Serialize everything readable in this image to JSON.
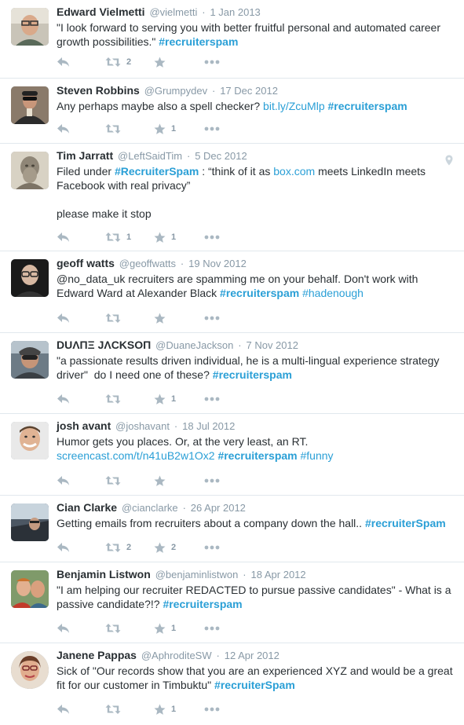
{
  "colors": {
    "link": "#2a9fd6",
    "muted": "#8899a6",
    "icon": "#aab8c2",
    "divider": "#e1e8ed"
  },
  "tweets": [
    {
      "fullname": "Edward Vielmetti",
      "username": "@vielmetti",
      "time": "1 Jan 2013",
      "segments": [
        {
          "t": "text",
          "v": "\"I look forward to serving you with better fruitful personal and automated career growth possibilities.\" "
        },
        {
          "t": "hashtag",
          "v": "#recruiterspam"
        }
      ],
      "retweets": "2",
      "likes": ""
    },
    {
      "fullname": "Steven Robbins",
      "username": "@Grumpydev",
      "time": "17 Dec 2012",
      "segments": [
        {
          "t": "text",
          "v": "Any perhaps maybe also a spell checker? "
        },
        {
          "t": "link",
          "v": "bit.ly/ZcuMlp"
        },
        {
          "t": "text",
          "v": " "
        },
        {
          "t": "hashtag",
          "v": "#recruiterspam"
        }
      ],
      "retweets": "",
      "likes": "1"
    },
    {
      "fullname": "Tim Jarratt",
      "username": "@LeftSaidTim",
      "time": "5 Dec 2012",
      "segments": [
        {
          "t": "text",
          "v": "Filed under "
        },
        {
          "t": "hashtag",
          "v": "#RecruiterSpam"
        },
        {
          "t": "text",
          "v": " : “think of it as "
        },
        {
          "t": "link",
          "v": "box.com"
        },
        {
          "t": "text",
          "v": " meets LinkedIn meets Facebook with real privacy”\n\nplease make it stop"
        }
      ],
      "retweets": "1",
      "likes": "1",
      "geo": true
    },
    {
      "fullname": "geoff watts",
      "username": "@geoffwatts",
      "time": "19 Nov 2012",
      "segments": [
        {
          "t": "text",
          "v": "@no_data_uk recruiters are spamming me on your behalf. Don't work with Edward Ward at Alexander Black "
        },
        {
          "t": "hashtag",
          "v": "#recruiterspam"
        },
        {
          "t": "text",
          "v": " "
        },
        {
          "t": "link",
          "v": "#hadenough"
        }
      ],
      "retweets": "",
      "likes": ""
    },
    {
      "fullname": "DUΛΠΞ JΛCKSOΠ",
      "username": "@DuaneJackson",
      "time": "7 Nov 2012",
      "segments": [
        {
          "t": "text",
          "v": "\"a passionate results driven individual, he is a multi-lingual experience strategy driver\"  do I need one of these? "
        },
        {
          "t": "hashtag",
          "v": "#recruiterspam"
        }
      ],
      "retweets": "",
      "likes": "1"
    },
    {
      "fullname": "josh avant",
      "username": "@joshavant",
      "time": "18 Jul 2012",
      "segments": [
        {
          "t": "text",
          "v": "Humor gets you places. Or, at the very least, an RT. "
        },
        {
          "t": "link",
          "v": "screencast.com/t/n41uB2w1Ox2"
        },
        {
          "t": "text",
          "v": " "
        },
        {
          "t": "hashtag",
          "v": "#recruiterspam"
        },
        {
          "t": "text",
          "v": " "
        },
        {
          "t": "link",
          "v": "#funny"
        }
      ],
      "retweets": "",
      "likes": ""
    },
    {
      "fullname": "Cian Clarke",
      "username": "@cianclarke",
      "time": "26 Apr 2012",
      "segments": [
        {
          "t": "text",
          "v": "Getting emails from recruiters about a company down the hall.. "
        },
        {
          "t": "hashtag",
          "v": "#recruiterSpam"
        }
      ],
      "retweets": "2",
      "likes": "2"
    },
    {
      "fullname": "Benjamin Listwon",
      "username": "@benjaminlistwon",
      "time": "18 Apr 2012",
      "segments": [
        {
          "t": "text",
          "v": "\"I am helping our recruiter REDACTED to pursue passive candidates\" - What is a passive candidate?!? "
        },
        {
          "t": "hashtag",
          "v": "#recruiterspam"
        }
      ],
      "retweets": "",
      "likes": "1"
    },
    {
      "fullname": "Janene Pappas",
      "username": "@AphroditeSW",
      "time": "12 Apr 2012",
      "segments": [
        {
          "t": "text",
          "v": "Sick of \"Our records show that you are an experienced XYZ and would be a great fit for our customer in Timbuktu\" "
        },
        {
          "t": "hashtag",
          "v": "#recruiterSpam"
        }
      ],
      "retweets": "",
      "likes": "1"
    }
  ]
}
